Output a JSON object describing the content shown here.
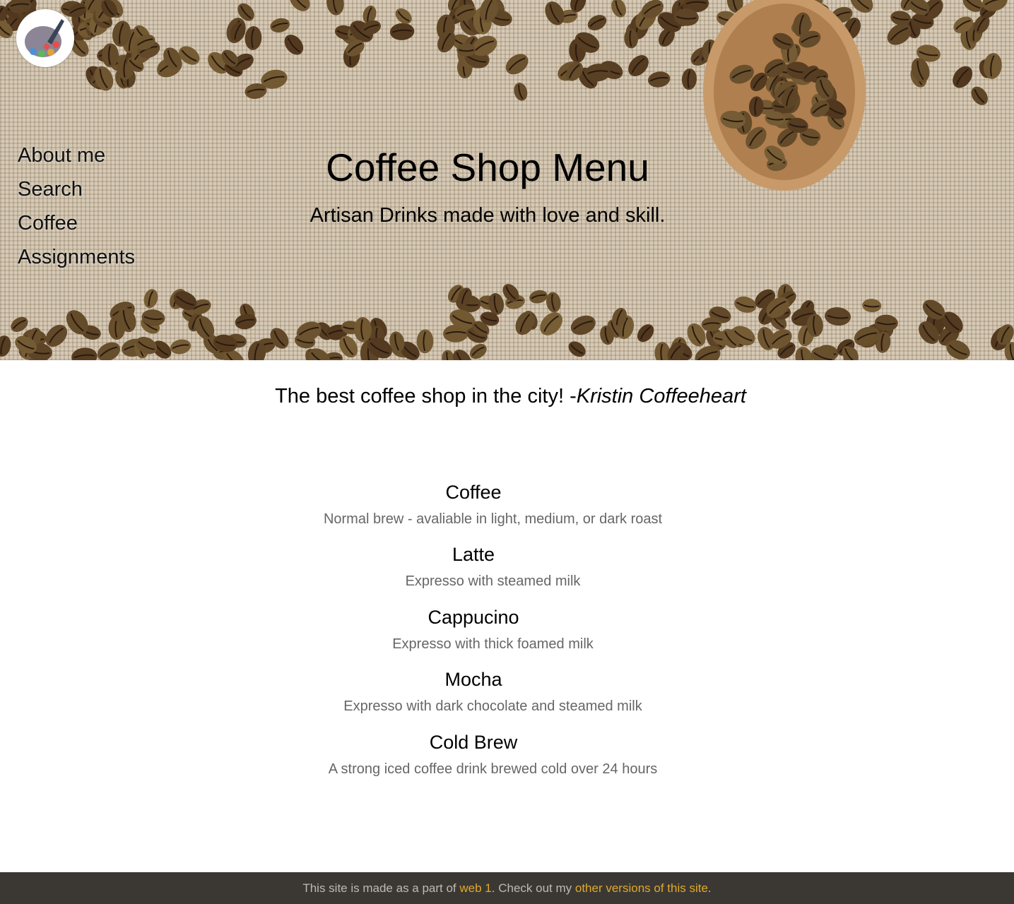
{
  "logo": {
    "icon": "paint-palette-icon"
  },
  "nav": {
    "items": [
      {
        "label": "About me"
      },
      {
        "label": "Search"
      },
      {
        "label": "Coffee"
      },
      {
        "label": "Assignments"
      }
    ]
  },
  "hero": {
    "title": "Coffee Shop Menu",
    "subtitle": "Artisan Drinks made with love and skill."
  },
  "quote": {
    "text": "The best coffee shop in the city! -",
    "author": "Kristin Coffeeheart"
  },
  "menu": {
    "items": [
      {
        "name": "Coffee",
        "description": "Normal brew - avaliable in light, medium, or dark roast"
      },
      {
        "name": "Latte",
        "description": "Expresso with steamed milk"
      },
      {
        "name": "Cappucino",
        "description": "Expresso with thick foamed milk"
      },
      {
        "name": "Mocha",
        "description": "Expresso with dark chocolate and steamed milk"
      },
      {
        "name": "Cold Brew",
        "description": "A strong iced coffee drink brewed cold over 24 hours"
      }
    ]
  },
  "footer": {
    "text_before": "This site is made as a part of ",
    "link1": "web 1",
    "text_middle": ". Check out my ",
    "link2": "other versions of this site",
    "text_after": ".",
    "link_color": "#e0a92a",
    "background": "#3b3834"
  }
}
